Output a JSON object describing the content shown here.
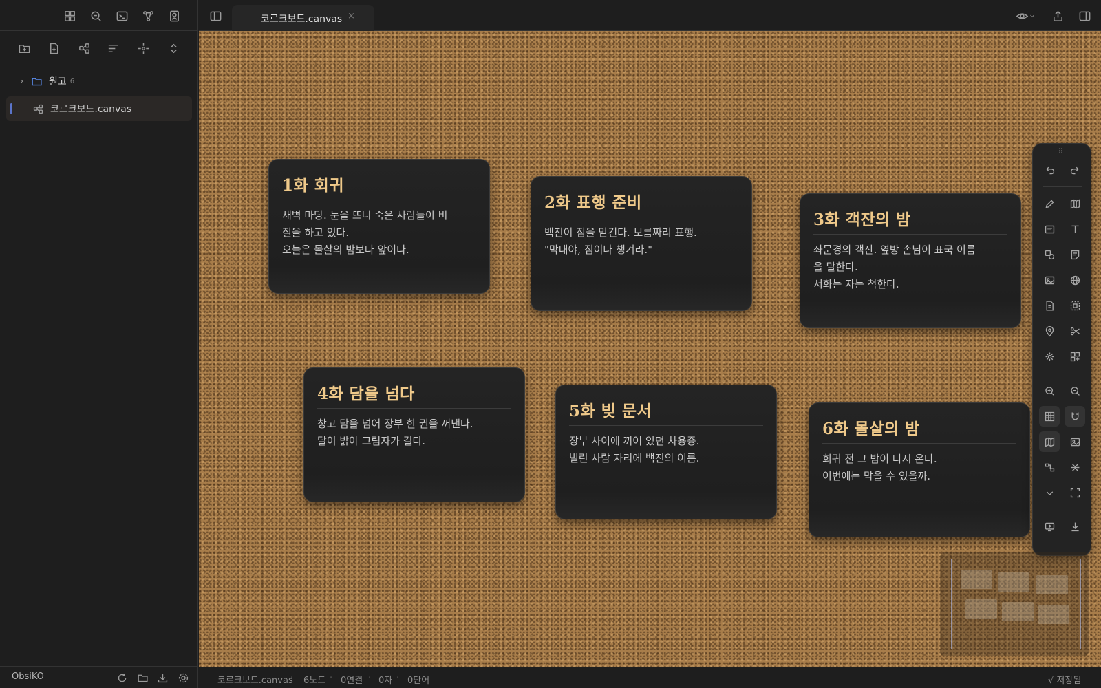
{
  "sidebar": {
    "top_icons": [
      "layout-grid-icon",
      "search-icon",
      "terminal-icon",
      "graph-icon",
      "contacts-icon"
    ],
    "tool_icons": [
      "new-folder-icon",
      "new-note-icon",
      "new-canvas-icon",
      "sort-icon",
      "reveal-icon",
      "collapse-icon"
    ],
    "tree": [
      {
        "type": "folder",
        "label": "원고",
        "count": "6",
        "icon": "folder-icon"
      },
      {
        "type": "file",
        "label": "코르크보드.canvas",
        "icon": "canvas-icon",
        "active": true
      }
    ],
    "vault_name": "ObsiKO",
    "bottom_icons": [
      "sync-icon",
      "open-vault-icon",
      "download-icon",
      "settings-icon"
    ]
  },
  "tabs": [
    {
      "title": "코르크보드.canvas",
      "close": "×",
      "active": true
    }
  ],
  "header_right_icons": [
    "view-mode-icon",
    "share-icon",
    "right-sidebar-icon"
  ],
  "canvas": {
    "background": "corkboard",
    "cards": [
      {
        "title": "1화 회귀",
        "body": "새벽 마당. 눈을 뜨니 죽은 사람들이 비\n질을 하고 있다.\n오늘은 몰살의 밤보다 앞이다."
      },
      {
        "title": "2화 표행 준비",
        "body": "백진이 짐을 맡긴다. 보름짜리 표행.\n\"막내야, 짐이나 챙겨라.\""
      },
      {
        "title": "3화 객잔의 밤",
        "body": "좌문경의 객잔. 옆방 손님이 표국 이름\n을 말한다.\n서화는 자는 척한다."
      },
      {
        "title": "4화 담을 넘다",
        "body": "창고 담을 넘어 장부 한 권을 꺼낸다.\n달이 밝아 그림자가 길다."
      },
      {
        "title": "5화 빚 문서",
        "body": "장부 사이에 끼어 있던 차용증.\n빌린 사람 자리에 백진의 이름."
      },
      {
        "title": "6화 몰살의 밤",
        "body": "회귀 전 그 밤이 다시 온다.\n이번에는 막을 수 있을까."
      }
    ]
  },
  "toolbar": {
    "drag_handle": "⠿",
    "tools": [
      "undo-icon",
      "redo-icon",
      "pen-icon",
      "map-icon",
      "card-icon",
      "text-icon",
      "shapes-icon",
      "note-icon",
      "image-icon",
      "web-icon",
      "file-icon",
      "group-icon",
      "pin-icon",
      "connect-icon",
      "sparkle-icon",
      "widgets-icon",
      "zoom-in-icon",
      "zoom-out-icon",
      "grid-icon",
      "magnet-icon",
      "minimap-icon",
      "image-export-icon",
      "arrange-icon",
      "collapse-edges-icon",
      "chevron-down-icon",
      "fullscreen-icon",
      "present-icon",
      "download-icon"
    ]
  },
  "status": {
    "file": "코르크보드.canvas",
    "nodes": "6노드",
    "edges": "0연결",
    "chars": "0자",
    "words": "0단어",
    "saved": "√ 저장됨"
  },
  "colors": {
    "accent": "#5b74c9",
    "card_title": "#efc98a",
    "cork": "#a87d4a",
    "folder_icon": "#5b8def"
  }
}
